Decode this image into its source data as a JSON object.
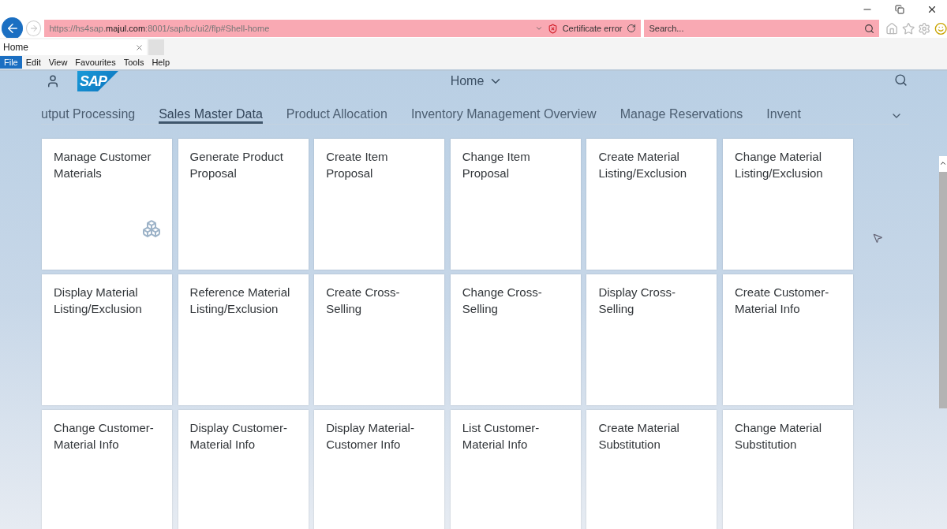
{
  "browser": {
    "url": "https://hs4sap.**majul.com**:8001/sap/bc/ui2/flp#Shell-home",
    "certificate": "Certificate error",
    "search_placeholder": "Search...",
    "tab_title": "Home",
    "menu": [
      {
        "label": "File",
        "selected": true
      },
      {
        "label": "Edit",
        "selected": false
      },
      {
        "label": "View",
        "selected": false
      },
      {
        "label": "Favourites",
        "selected": false
      },
      {
        "label": "Tools",
        "selected": false
      },
      {
        "label": "Help",
        "selected": false
      }
    ]
  },
  "shell": {
    "title": "Home",
    "logo": "SAP"
  },
  "tabs": [
    {
      "label": "utput Processing",
      "selected": false
    },
    {
      "label": "Sales Master Data",
      "selected": true
    },
    {
      "label": "Product Allocation",
      "selected": false
    },
    {
      "label": "Inventory Management Overview",
      "selected": false
    },
    {
      "label": "Manage Reservations",
      "selected": false
    },
    {
      "label": "Invent",
      "selected": false
    }
  ],
  "tiles": [
    {
      "title": "Manage Customer Materials",
      "has_icon": true
    },
    {
      "title": "Generate Product Proposal",
      "has_icon": false
    },
    {
      "title": "Create Item Proposal",
      "has_icon": false
    },
    {
      "title": "Change Item Proposal",
      "has_icon": false
    },
    {
      "title": "Create Material Listing/Exclusion",
      "has_icon": false
    },
    {
      "title": "Change Material Listing/Exclusion",
      "has_icon": false
    },
    {
      "title": "Display Material Listing/Exclusion",
      "has_icon": false
    },
    {
      "title": "Reference Material Listing/Exclusion",
      "has_icon": false
    },
    {
      "title": "Create Cross-Selling",
      "has_icon": false
    },
    {
      "title": "Change Cross-Selling",
      "has_icon": false
    },
    {
      "title": "Display Cross-Selling",
      "has_icon": false
    },
    {
      "title": "Create Customer-Material Info",
      "has_icon": false
    },
    {
      "title": "Change Customer-Material Info",
      "has_icon": false
    },
    {
      "title": "Display Customer-Material Info",
      "has_icon": false
    },
    {
      "title": "Display Material-Customer Info",
      "has_icon": false
    },
    {
      "title": "List Customer-Material Info",
      "has_icon": false
    },
    {
      "title": "Create Material Substitution",
      "has_icon": false
    },
    {
      "title": "Change Material Substitution",
      "has_icon": false
    }
  ]
}
